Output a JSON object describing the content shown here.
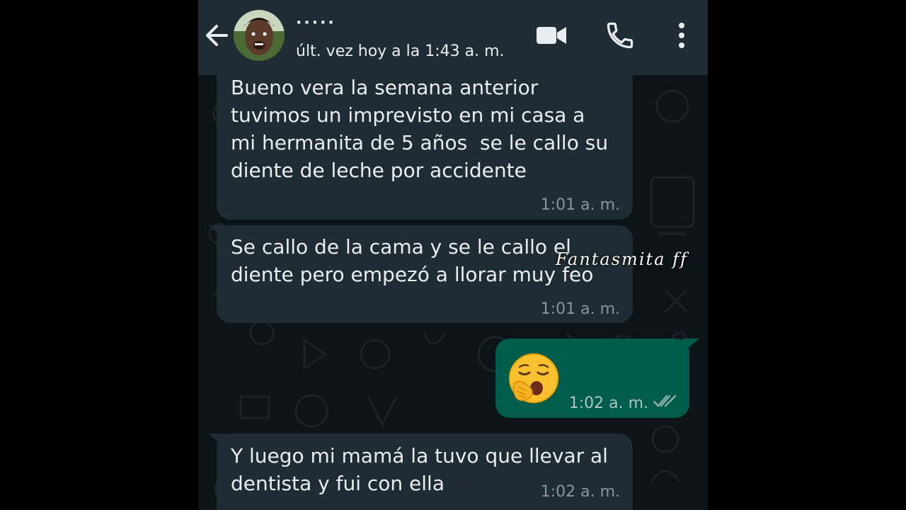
{
  "header": {
    "contact_name": "·····",
    "last_seen": "últ. vez hoy a la 1:43 a. m."
  },
  "messages": [
    {
      "direction": "in",
      "text": "Bueno vera la semana anterior\ntuvimos un imprevisto en mi casa a\nmi hermanita de 5 años  se le callo su\ndiente de leche por accidente",
      "time": "1:01 a. m."
    },
    {
      "direction": "in",
      "text": "Se callo de la cama y se le callo el\ndiente pero empezó a llorar muy feo",
      "time": "1:01 a. m."
    },
    {
      "direction": "out",
      "emoji": "yawning-face",
      "time": "1:02 a. m.",
      "status": "read-double-check"
    },
    {
      "direction": "in",
      "text": "Y luego mi mamá la tuvo que llevar al\ndentista y fui con ella",
      "time": "1:02 a. m."
    }
  ],
  "watermark": "Fantasmita ff",
  "colors": {
    "header_bg": "#1f2c34",
    "chat_bg": "#0d1418",
    "incoming_bubble": "#1f2c34",
    "outgoing_bubble": "#005c4b",
    "read_tick": "#8696a0"
  },
  "icons": [
    "back-arrow-icon",
    "video-call-icon",
    "phone-call-icon",
    "more-options-icon",
    "double-check-icon"
  ]
}
